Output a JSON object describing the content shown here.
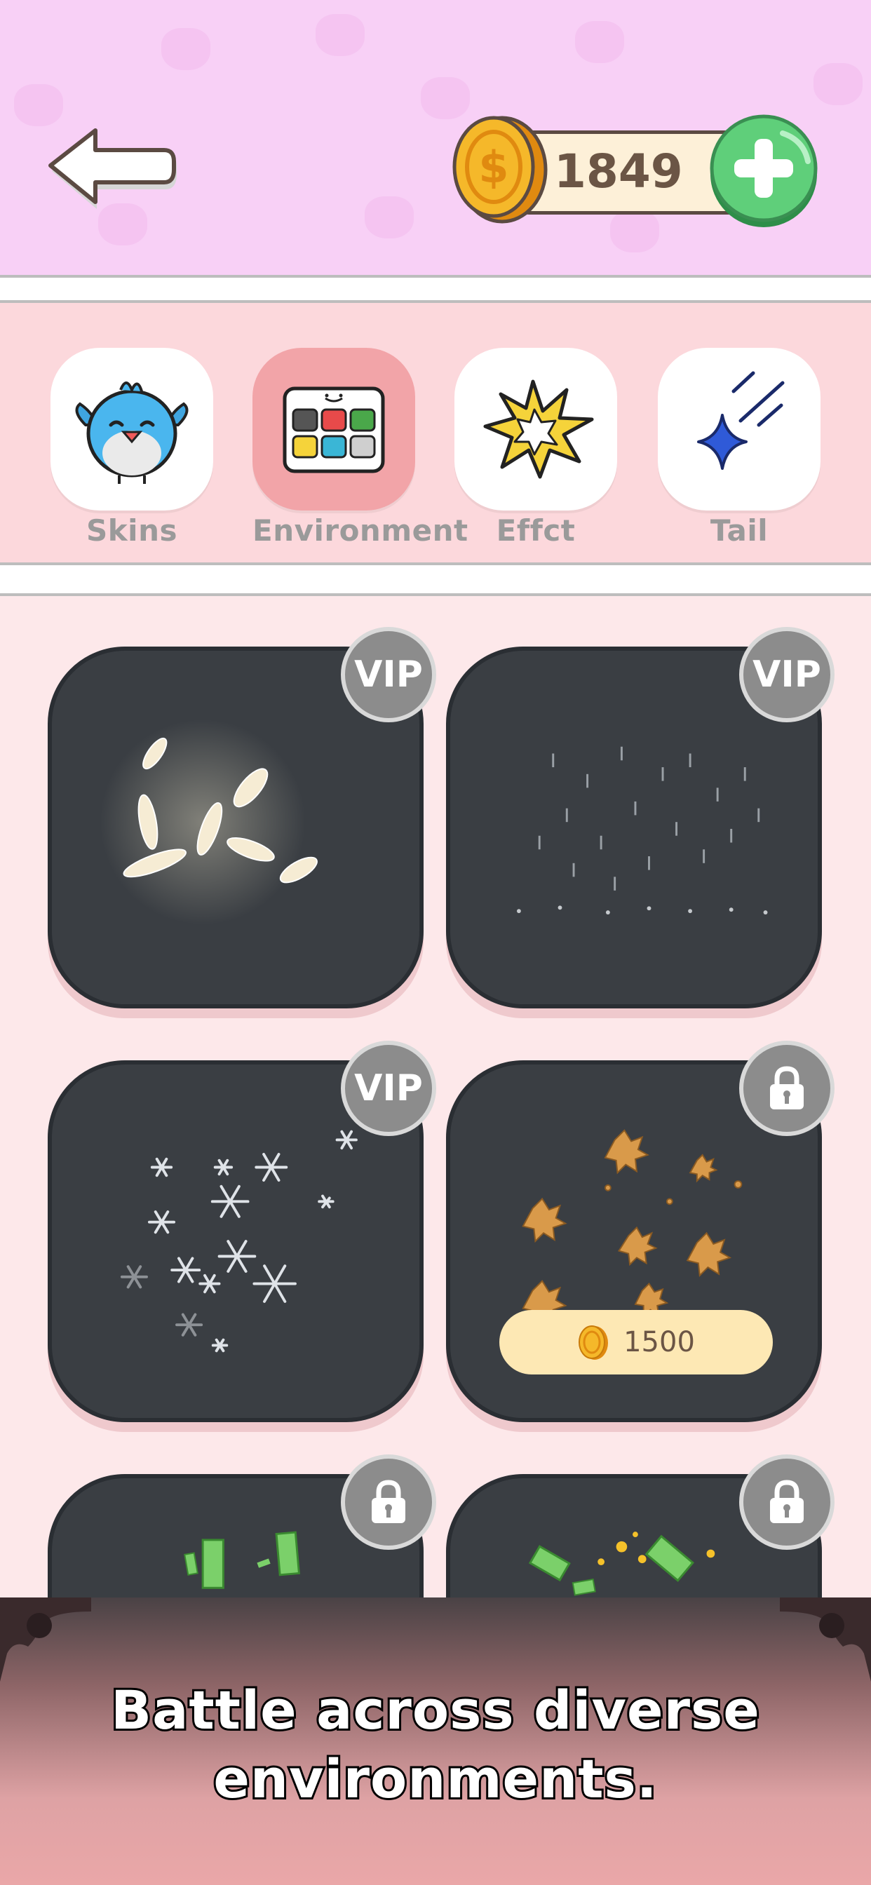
{
  "header": {
    "coins": "1849",
    "back_icon": "back-arrow-icon",
    "coin_icon": "dollar-coin-icon",
    "plus_icon": "plus-icon"
  },
  "tabs": [
    {
      "label": "Skins",
      "icon": "blue-bird-icon",
      "active": false
    },
    {
      "label": "Environment",
      "icon": "palette-grid-icon",
      "active": true
    },
    {
      "label": "Effct",
      "icon": "explosion-icon",
      "active": false
    },
    {
      "label": "Tail",
      "icon": "shooting-star-icon",
      "active": false
    }
  ],
  "cards": [
    {
      "effect": "feathers",
      "badge": "VIP"
    },
    {
      "effect": "rain",
      "badge": "VIP"
    },
    {
      "effect": "snowflakes",
      "badge": "VIP"
    },
    {
      "effect": "autumn-leaves",
      "badge": "lock",
      "price": "1500"
    },
    {
      "effect": "money",
      "badge": "lock"
    },
    {
      "effect": "cash-coins",
      "badge": "lock"
    }
  ],
  "footer": {
    "caption_line1": "Battle across diverse",
    "caption_line2": "environments."
  },
  "colors": {
    "header_bg": "#f8d0f6",
    "tabs_bg": "#fcd8dc",
    "active_tab": "#f2a4a8",
    "card_bg": "#3a3e43",
    "coin": "#f5b82a",
    "plus_green": "#5fcf7a"
  }
}
